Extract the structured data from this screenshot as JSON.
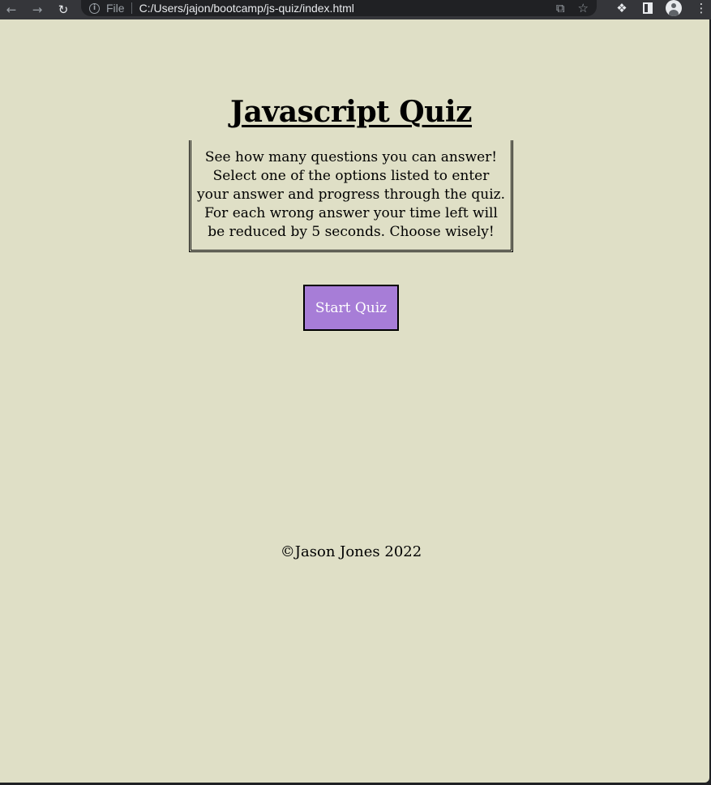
{
  "browser": {
    "scheme_label": "File",
    "url": "C:/Users/jajon/bootcamp/js-quiz/index.html",
    "icons": {
      "back": "arrow-left-icon",
      "forward": "arrow-right-icon",
      "reload": "reload-icon",
      "site_info": "info-icon",
      "share": "share-icon",
      "bookmark": "star-icon",
      "extensions": "puzzle-icon",
      "side_panel": "side-panel-icon",
      "profile": "profile-avatar-icon",
      "menu": "kebab-menu-icon"
    }
  },
  "page": {
    "background_color": "#dfdfc6",
    "title": "Javascript Quiz",
    "intro_lines": [
      "See how many questions you can answer!",
      "Select one of the options listed to enter",
      "your answer and progress through the quiz.",
      "For each wrong answer your time left will",
      "be reduced by 5 seconds. Choose wisely!"
    ],
    "start_button_label": "Start Quiz",
    "start_button_color": "#a77dd7",
    "footer_text": "©Jason Jones 2022"
  }
}
